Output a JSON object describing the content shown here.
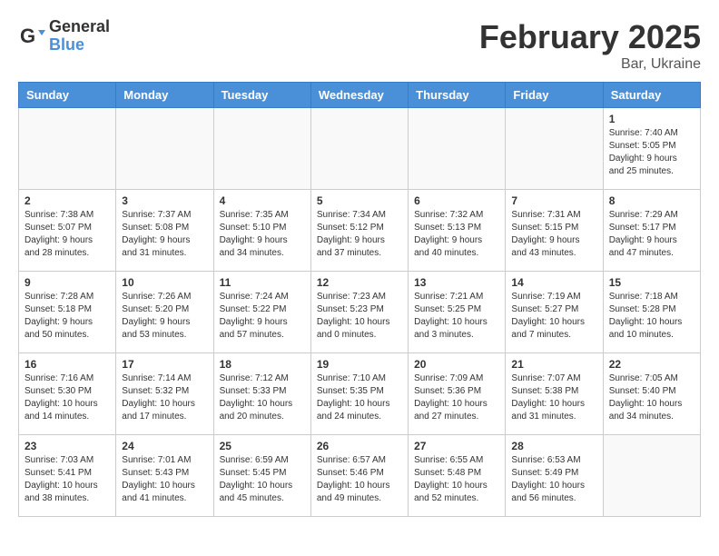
{
  "header": {
    "logo_general": "General",
    "logo_blue": "Blue",
    "month_title": "February 2025",
    "location": "Bar, Ukraine"
  },
  "columns": [
    "Sunday",
    "Monday",
    "Tuesday",
    "Wednesday",
    "Thursday",
    "Friday",
    "Saturday"
  ],
  "weeks": [
    [
      {
        "day": "",
        "info": ""
      },
      {
        "day": "",
        "info": ""
      },
      {
        "day": "",
        "info": ""
      },
      {
        "day": "",
        "info": ""
      },
      {
        "day": "",
        "info": ""
      },
      {
        "day": "",
        "info": ""
      },
      {
        "day": "1",
        "info": "Sunrise: 7:40 AM\nSunset: 5:05 PM\nDaylight: 9 hours and 25 minutes."
      }
    ],
    [
      {
        "day": "2",
        "info": "Sunrise: 7:38 AM\nSunset: 5:07 PM\nDaylight: 9 hours and 28 minutes."
      },
      {
        "day": "3",
        "info": "Sunrise: 7:37 AM\nSunset: 5:08 PM\nDaylight: 9 hours and 31 minutes."
      },
      {
        "day": "4",
        "info": "Sunrise: 7:35 AM\nSunset: 5:10 PM\nDaylight: 9 hours and 34 minutes."
      },
      {
        "day": "5",
        "info": "Sunrise: 7:34 AM\nSunset: 5:12 PM\nDaylight: 9 hours and 37 minutes."
      },
      {
        "day": "6",
        "info": "Sunrise: 7:32 AM\nSunset: 5:13 PM\nDaylight: 9 hours and 40 minutes."
      },
      {
        "day": "7",
        "info": "Sunrise: 7:31 AM\nSunset: 5:15 PM\nDaylight: 9 hours and 43 minutes."
      },
      {
        "day": "8",
        "info": "Sunrise: 7:29 AM\nSunset: 5:17 PM\nDaylight: 9 hours and 47 minutes."
      }
    ],
    [
      {
        "day": "9",
        "info": "Sunrise: 7:28 AM\nSunset: 5:18 PM\nDaylight: 9 hours and 50 minutes."
      },
      {
        "day": "10",
        "info": "Sunrise: 7:26 AM\nSunset: 5:20 PM\nDaylight: 9 hours and 53 minutes."
      },
      {
        "day": "11",
        "info": "Sunrise: 7:24 AM\nSunset: 5:22 PM\nDaylight: 9 hours and 57 minutes."
      },
      {
        "day": "12",
        "info": "Sunrise: 7:23 AM\nSunset: 5:23 PM\nDaylight: 10 hours and 0 minutes."
      },
      {
        "day": "13",
        "info": "Sunrise: 7:21 AM\nSunset: 5:25 PM\nDaylight: 10 hours and 3 minutes."
      },
      {
        "day": "14",
        "info": "Sunrise: 7:19 AM\nSunset: 5:27 PM\nDaylight: 10 hours and 7 minutes."
      },
      {
        "day": "15",
        "info": "Sunrise: 7:18 AM\nSunset: 5:28 PM\nDaylight: 10 hours and 10 minutes."
      }
    ],
    [
      {
        "day": "16",
        "info": "Sunrise: 7:16 AM\nSunset: 5:30 PM\nDaylight: 10 hours and 14 minutes."
      },
      {
        "day": "17",
        "info": "Sunrise: 7:14 AM\nSunset: 5:32 PM\nDaylight: 10 hours and 17 minutes."
      },
      {
        "day": "18",
        "info": "Sunrise: 7:12 AM\nSunset: 5:33 PM\nDaylight: 10 hours and 20 minutes."
      },
      {
        "day": "19",
        "info": "Sunrise: 7:10 AM\nSunset: 5:35 PM\nDaylight: 10 hours and 24 minutes."
      },
      {
        "day": "20",
        "info": "Sunrise: 7:09 AM\nSunset: 5:36 PM\nDaylight: 10 hours and 27 minutes."
      },
      {
        "day": "21",
        "info": "Sunrise: 7:07 AM\nSunset: 5:38 PM\nDaylight: 10 hours and 31 minutes."
      },
      {
        "day": "22",
        "info": "Sunrise: 7:05 AM\nSunset: 5:40 PM\nDaylight: 10 hours and 34 minutes."
      }
    ],
    [
      {
        "day": "23",
        "info": "Sunrise: 7:03 AM\nSunset: 5:41 PM\nDaylight: 10 hours and 38 minutes."
      },
      {
        "day": "24",
        "info": "Sunrise: 7:01 AM\nSunset: 5:43 PM\nDaylight: 10 hours and 41 minutes."
      },
      {
        "day": "25",
        "info": "Sunrise: 6:59 AM\nSunset: 5:45 PM\nDaylight: 10 hours and 45 minutes."
      },
      {
        "day": "26",
        "info": "Sunrise: 6:57 AM\nSunset: 5:46 PM\nDaylight: 10 hours and 49 minutes."
      },
      {
        "day": "27",
        "info": "Sunrise: 6:55 AM\nSunset: 5:48 PM\nDaylight: 10 hours and 52 minutes."
      },
      {
        "day": "28",
        "info": "Sunrise: 6:53 AM\nSunset: 5:49 PM\nDaylight: 10 hours and 56 minutes."
      },
      {
        "day": "",
        "info": ""
      }
    ]
  ]
}
